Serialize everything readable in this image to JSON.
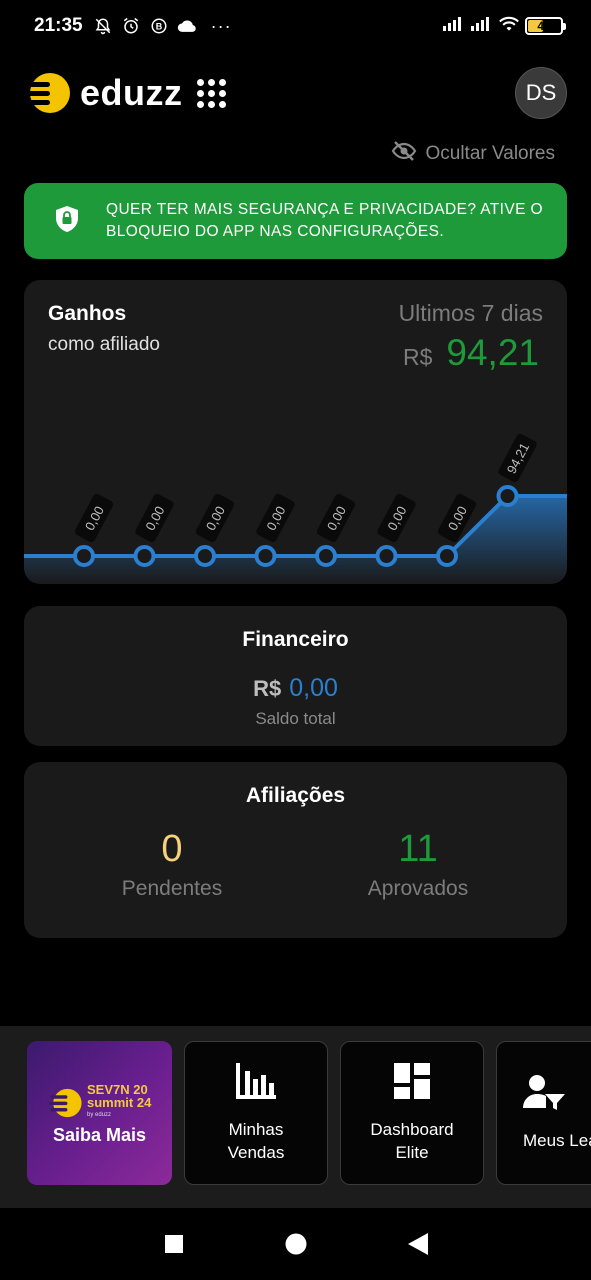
{
  "status_bar": {
    "time": "21:35",
    "notification_icons": [
      "bell-off-icon",
      "alarm-icon",
      "b-circle-icon",
      "cloud-icon"
    ],
    "more": "···",
    "battery_level": "43"
  },
  "header": {
    "logo_text": "eduzz",
    "avatar_initials": "DS"
  },
  "hide_values_label": "Ocultar Valores",
  "banner": {
    "text_line1": "QUER TER MAIS SEGURANÇA E PRIVACIDADE? ATIVE O",
    "text_line2": "BLOQUEIO DO APP NAS CONFIGURAÇÕES."
  },
  "earnings": {
    "title": "Ganhos",
    "subtitle": "como afiliado",
    "period": "Ultimos 7 dias",
    "currency": "R$",
    "value": "94,21"
  },
  "chart_data": {
    "type": "area",
    "title": "",
    "values": [
      0,
      0,
      0,
      0,
      0,
      0,
      0,
      94.21
    ],
    "labels": [
      "0,00",
      "0,00",
      "0,00",
      "0,00",
      "0,00",
      "0,00",
      "0,00",
      "94,21"
    ],
    "ylim": [
      0,
      94.21
    ],
    "grid": false,
    "line_color": "#2a7fd0"
  },
  "financial": {
    "title": "Financeiro",
    "currency": "R$",
    "value": "0,00",
    "label": "Saldo total"
  },
  "affiliations": {
    "title": "Afiliações",
    "pending_value": "0",
    "pending_label": "Pendentes",
    "approved_value": "11",
    "approved_label": "Aprovados"
  },
  "shortcuts": {
    "promo": {
      "brand_line1": "SEV7N 20",
      "brand_line2": "summit 24",
      "brand_small": "by eduzz",
      "label": "Saiba Mais"
    },
    "items": [
      {
        "label_line1": "Minhas",
        "label_line2": "Vendas",
        "icon": "bar-chart-icon"
      },
      {
        "label_line1": "Dashboard",
        "label_line2": "Elite",
        "icon": "dashboard-icon"
      },
      {
        "label_line1": "Meus Leads",
        "label_line2": "",
        "icon": "user-filter-icon"
      }
    ]
  },
  "colors": {
    "accent_green": "#1f9a3a",
    "accent_blue": "#2a7fd0",
    "pending_yellow": "#f5d27a",
    "logo_yellow": "#f5c400"
  }
}
